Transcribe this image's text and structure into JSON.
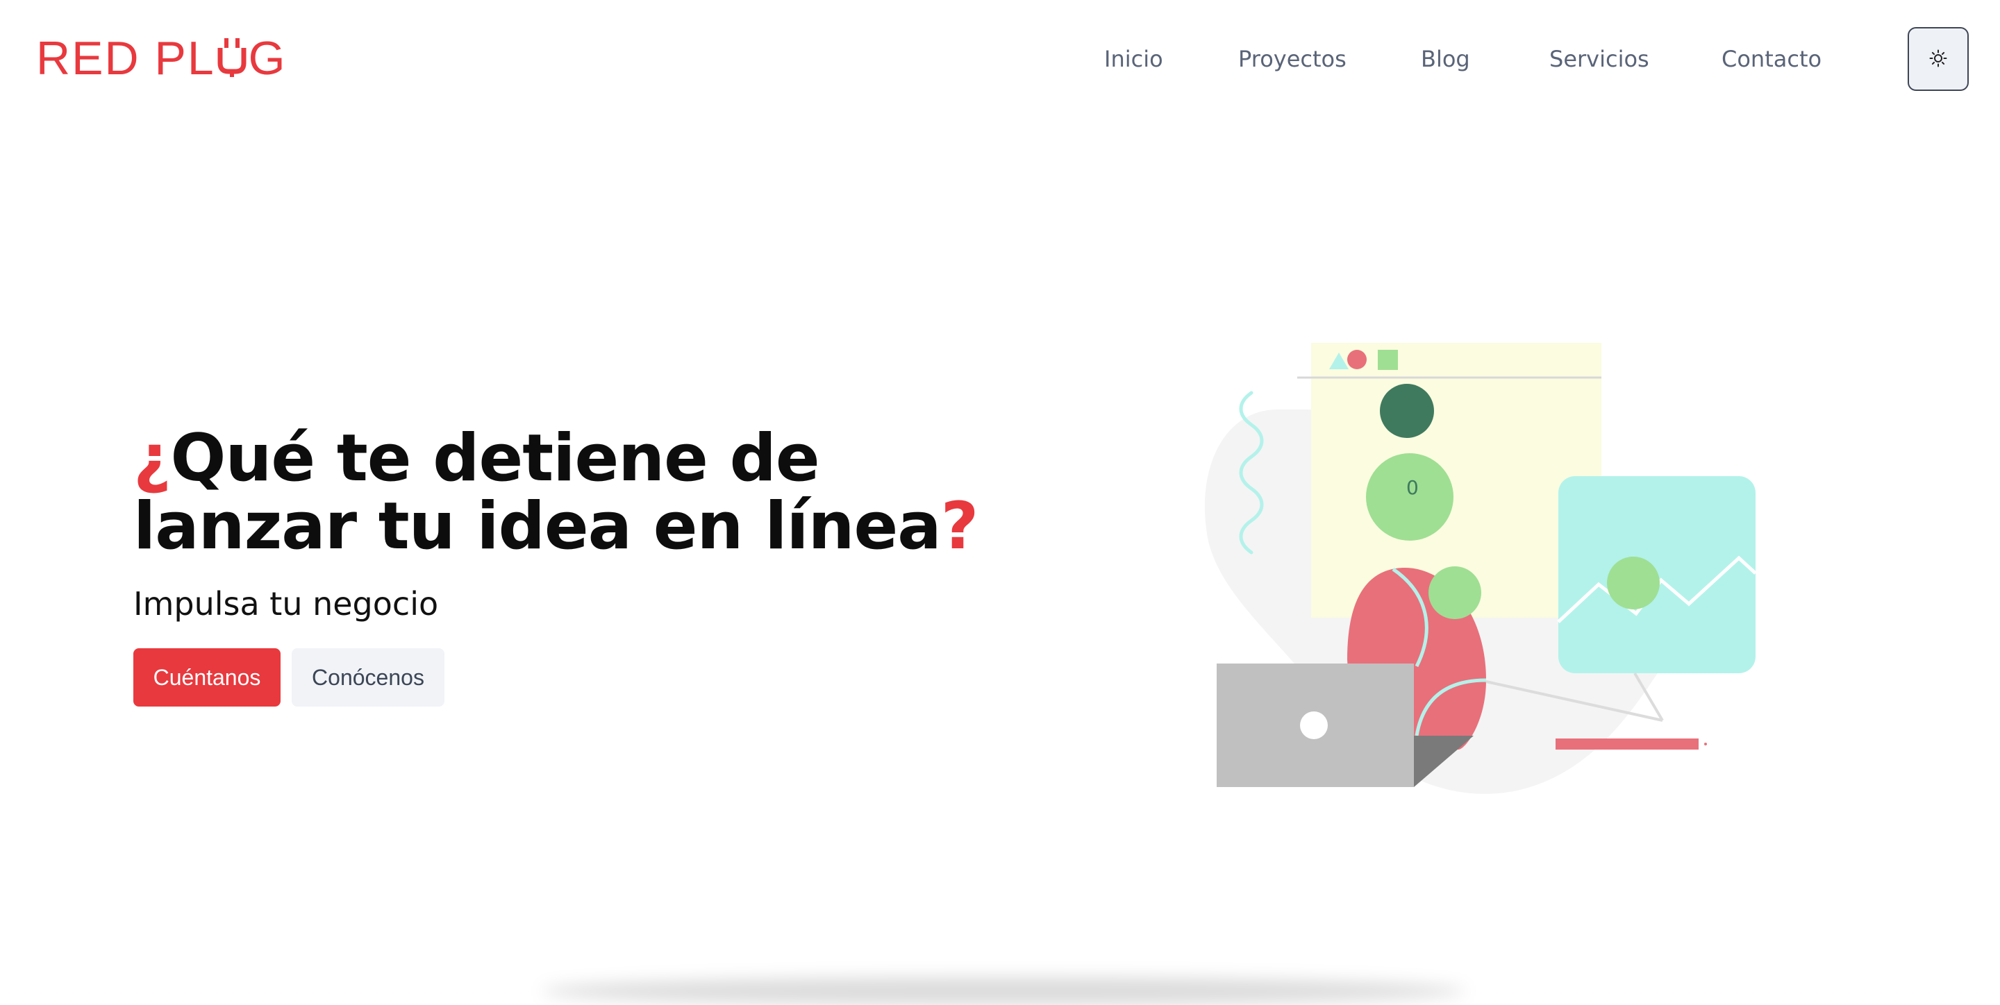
{
  "brand": {
    "logo_left": "RED PL",
    "logo_right": "G"
  },
  "nav": {
    "items": [
      {
        "label": "Inicio"
      },
      {
        "label": "Proyectos"
      },
      {
        "label": "Blog"
      },
      {
        "label": "Servicios"
      },
      {
        "label": "Contacto"
      }
    ],
    "theme_toggle_icon": "sun-icon"
  },
  "hero": {
    "title_mark_open": "¿",
    "title_text": "Qué te detiene de lanzar tu idea en línea",
    "title_mark_close": "?",
    "subtitle": "Impulsa tu negocio",
    "primary_button": "Cuéntanos",
    "secondary_button": "Conócenos"
  },
  "illustration": {
    "digit": "0"
  },
  "colors": {
    "accent": "#e8393e",
    "nav_text": "#5a6478",
    "mint": "#b3f2ea",
    "green": "#9fdf93",
    "dark_green": "#3f7a5e",
    "pink": "#e8707b"
  }
}
